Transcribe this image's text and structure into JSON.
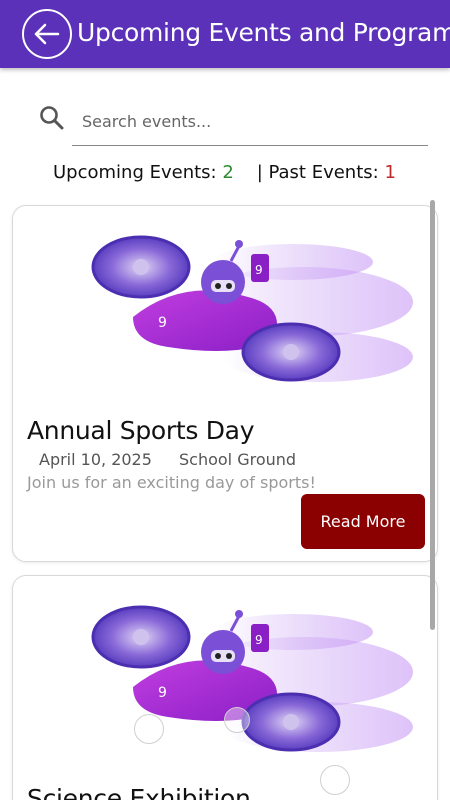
{
  "header": {
    "title": "Upcoming Events and Programs",
    "back_icon": "arrow-left-icon",
    "color": "#5a31b8"
  },
  "search": {
    "placeholder": "Search events...",
    "value": "",
    "icon": "search-icon"
  },
  "stats": {
    "upcoming_label": "Upcoming Events:",
    "upcoming_count": "2",
    "past_label": "| Past Events:",
    "past_count": "1"
  },
  "events": [
    {
      "title": "Annual Sports Day",
      "date": "April 10, 2025",
      "location": "School Ground",
      "description": "Join us for an exciting day of sports!",
      "button_label": "Read More",
      "image_icon": "flying-robot-drone-illustration"
    },
    {
      "title": "Science Exhibition",
      "image_icon": "flying-robot-drone-illustration"
    }
  ],
  "colors": {
    "accent": "#5a31b8",
    "button": "#8b0000",
    "upcoming": "#2e8b2e",
    "past": "#c0282d"
  }
}
